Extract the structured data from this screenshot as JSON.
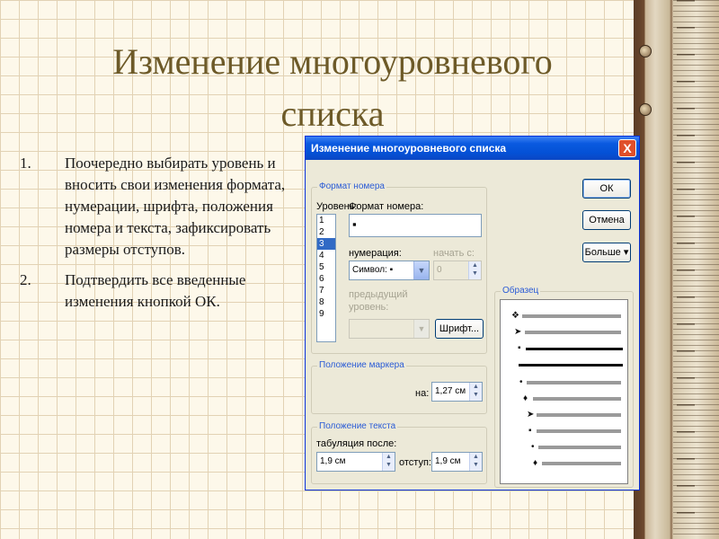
{
  "slide": {
    "title_line1": "Изменение многоуровневого",
    "title_line2": "списка",
    "steps": [
      {
        "num": "1.",
        "text": "Поочередно выбирать уровень и вносить свои изменения формата, нумерации, шрифта, положения номера и текста, зафиксировать размеры отступов."
      },
      {
        "num": "2.",
        "text": "Подтвердить все введенные изменения кнопкой ОК."
      }
    ]
  },
  "dialog": {
    "title": "Изменение многоуровневого списка",
    "close_glyph": "X",
    "format_group": "Формат номера",
    "level_label": "Уровень:",
    "levels": [
      "1",
      "2",
      "3",
      "4",
      "5",
      "6",
      "7",
      "8",
      "9"
    ],
    "selected_level": "3",
    "number_format_label": "Формат номера:",
    "number_format_value": "▪",
    "numbering_label": "нумерация:",
    "numbering_value": "Символ: ▪",
    "start_label": "начать с:",
    "start_value": "0",
    "prev_level_label1": "предыдущий",
    "prev_level_label2": "уровень:",
    "prev_level_value": "",
    "font_button": "Шрифт...",
    "ok_button": "ОК",
    "cancel_button": "Отмена",
    "more_button": "Больше ▾",
    "marker_group": "Положение маркера",
    "marker_at_label": "на:",
    "marker_at_value": "1,27 см",
    "text_group": "Положение текста",
    "tab_after_label": "табуляция после:",
    "tab_after_value": "1,9 см",
    "indent_label": "отступ:",
    "indent_value": "1,9 см",
    "preview_group": "Образец",
    "preview_markers": [
      "❖",
      "➤",
      "▪",
      "",
      "•",
      "♦",
      "➤",
      "▪",
      "•",
      "♦"
    ]
  },
  "colors": {
    "title": "#6d5a28",
    "titlebar": "#0451d6",
    "accent": "#2a5bd6"
  }
}
